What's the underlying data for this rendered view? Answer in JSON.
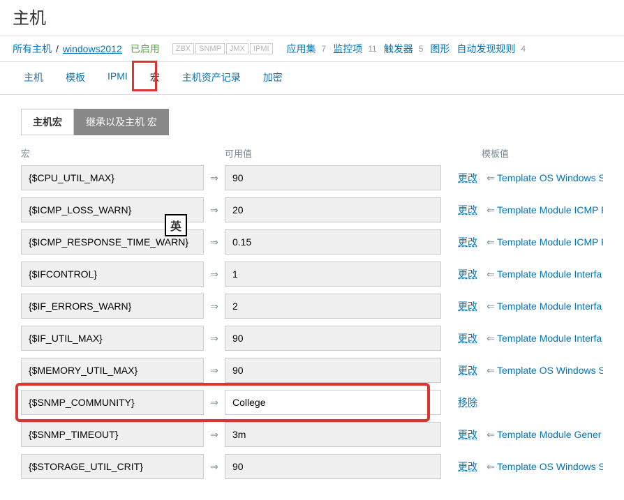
{
  "page_title": "主机",
  "breadcrumb": {
    "all_hosts": "所有主机",
    "host_name": "windows2012",
    "status": "已启用",
    "protocols": [
      "ZBX",
      "SNMP",
      "JMX",
      "IPMI"
    ],
    "stats": [
      {
        "label": "应用集",
        "count": "7"
      },
      {
        "label": "监控项",
        "count": "11"
      },
      {
        "label": "触发器",
        "count": "5"
      },
      {
        "label": "图形",
        "count": ""
      },
      {
        "label": "自动发现规则",
        "count": "4"
      }
    ]
  },
  "tabs": [
    "主机",
    "模板",
    "IPMI",
    "宏",
    "主机资产记录",
    "加密"
  ],
  "sub_tabs": {
    "active": "主机宏",
    "inactive": "继承以及主机 宏"
  },
  "columns": {
    "macro": "宏",
    "value": "可用值",
    "template": "模板值"
  },
  "ime_badge": "英",
  "change_label": "更改",
  "remove_label": "移除",
  "arrow_right": "⇒",
  "arrow_left": "⇐",
  "rows": [
    {
      "macro": "{$CPU_UTIL_MAX}",
      "value": "90",
      "action": "change",
      "template": "Template OS Windows S",
      "value_bg": "gray"
    },
    {
      "macro": "{$ICMP_LOSS_WARN}",
      "value": "20",
      "action": "change",
      "template": "Template Module ICMP P",
      "value_bg": "gray"
    },
    {
      "macro": "{$ICMP_RESPONSE_TIME_WARN}",
      "value": "0.15",
      "action": "change",
      "template": "Template Module ICMP P",
      "value_bg": "gray",
      "show_ime": true
    },
    {
      "macro": "{$IFCONTROL}",
      "value": "1",
      "action": "change",
      "template": "Template Module Interfa",
      "value_bg": "gray"
    },
    {
      "macro": "{$IF_ERRORS_WARN}",
      "value": "2",
      "action": "change",
      "template": "Template Module Interfa",
      "value_bg": "gray"
    },
    {
      "macro": "{$IF_UTIL_MAX}",
      "value": "90",
      "action": "change",
      "template": "Template Module Interfa",
      "value_bg": "gray"
    },
    {
      "macro": "{$MEMORY_UTIL_MAX}",
      "value": "90",
      "action": "change",
      "template": "Template OS Windows S",
      "value_bg": "gray"
    },
    {
      "macro": "{$SNMP_COMMUNITY}",
      "value": "College",
      "action": "remove",
      "template": "",
      "value_bg": "white",
      "highlight": true
    },
    {
      "macro": "{$SNMP_TIMEOUT}",
      "value": "3m",
      "action": "change",
      "template": "Template Module Gener",
      "value_bg": "gray"
    },
    {
      "macro": "{$STORAGE_UTIL_CRIT}",
      "value": "90",
      "action": "change",
      "template": "Template OS Windows S",
      "value_bg": "gray"
    }
  ]
}
